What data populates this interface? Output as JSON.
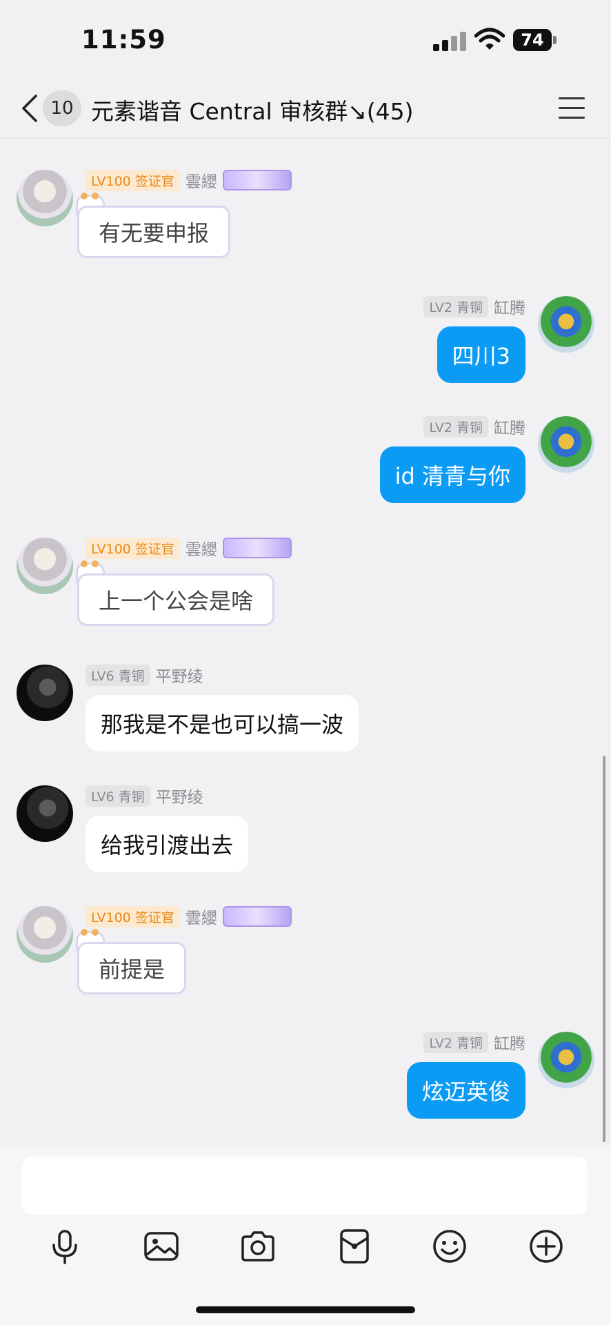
{
  "status_bar": {
    "time": "11:59",
    "battery": "74",
    "icons": [
      "signal-icon",
      "wifi-icon",
      "battery-icon"
    ]
  },
  "nav": {
    "unread_count": "10",
    "title": "元素谐音 Central 审核群↘(45)",
    "icons": [
      "back-arrow-icon",
      "menu-icon"
    ]
  },
  "messages": [
    {
      "side": "left",
      "level": "LV100 签证官",
      "name": "雲纓",
      "text": "有无要申报",
      "style": "cat"
    },
    {
      "side": "right",
      "level": "LV2 青铜",
      "name": "缸腾",
      "text": "四川3"
    },
    {
      "side": "right",
      "level": "LV2 青铜",
      "name": "缸腾",
      "text": "id 清青与你"
    },
    {
      "side": "left",
      "level": "LV100 签证官",
      "name": "雲纓",
      "text": "上一个公会是啥",
      "style": "cat"
    },
    {
      "side": "left",
      "level": "LV6 青铜",
      "name": "平野绫",
      "text": "那我是不是也可以搞一波"
    },
    {
      "side": "left",
      "level": "LV6 青铜",
      "name": "平野绫",
      "text": "给我引渡出去"
    },
    {
      "side": "left",
      "level": "LV100 签证官",
      "name": "雲纓",
      "text": "前提是",
      "style": "cat"
    },
    {
      "side": "right",
      "level": "LV2 青铜",
      "name": "缸腾",
      "text": "炫迈英俊"
    }
  ],
  "toolbar": {
    "icons": [
      "microphone-icon",
      "image-icon",
      "camera-icon",
      "red-packet-icon",
      "emoji-icon",
      "plus-icon"
    ]
  },
  "colors": {
    "sent_bubble": "#0b9bf5",
    "background": "#f1f1f3",
    "level_gold": "#e58a18"
  }
}
